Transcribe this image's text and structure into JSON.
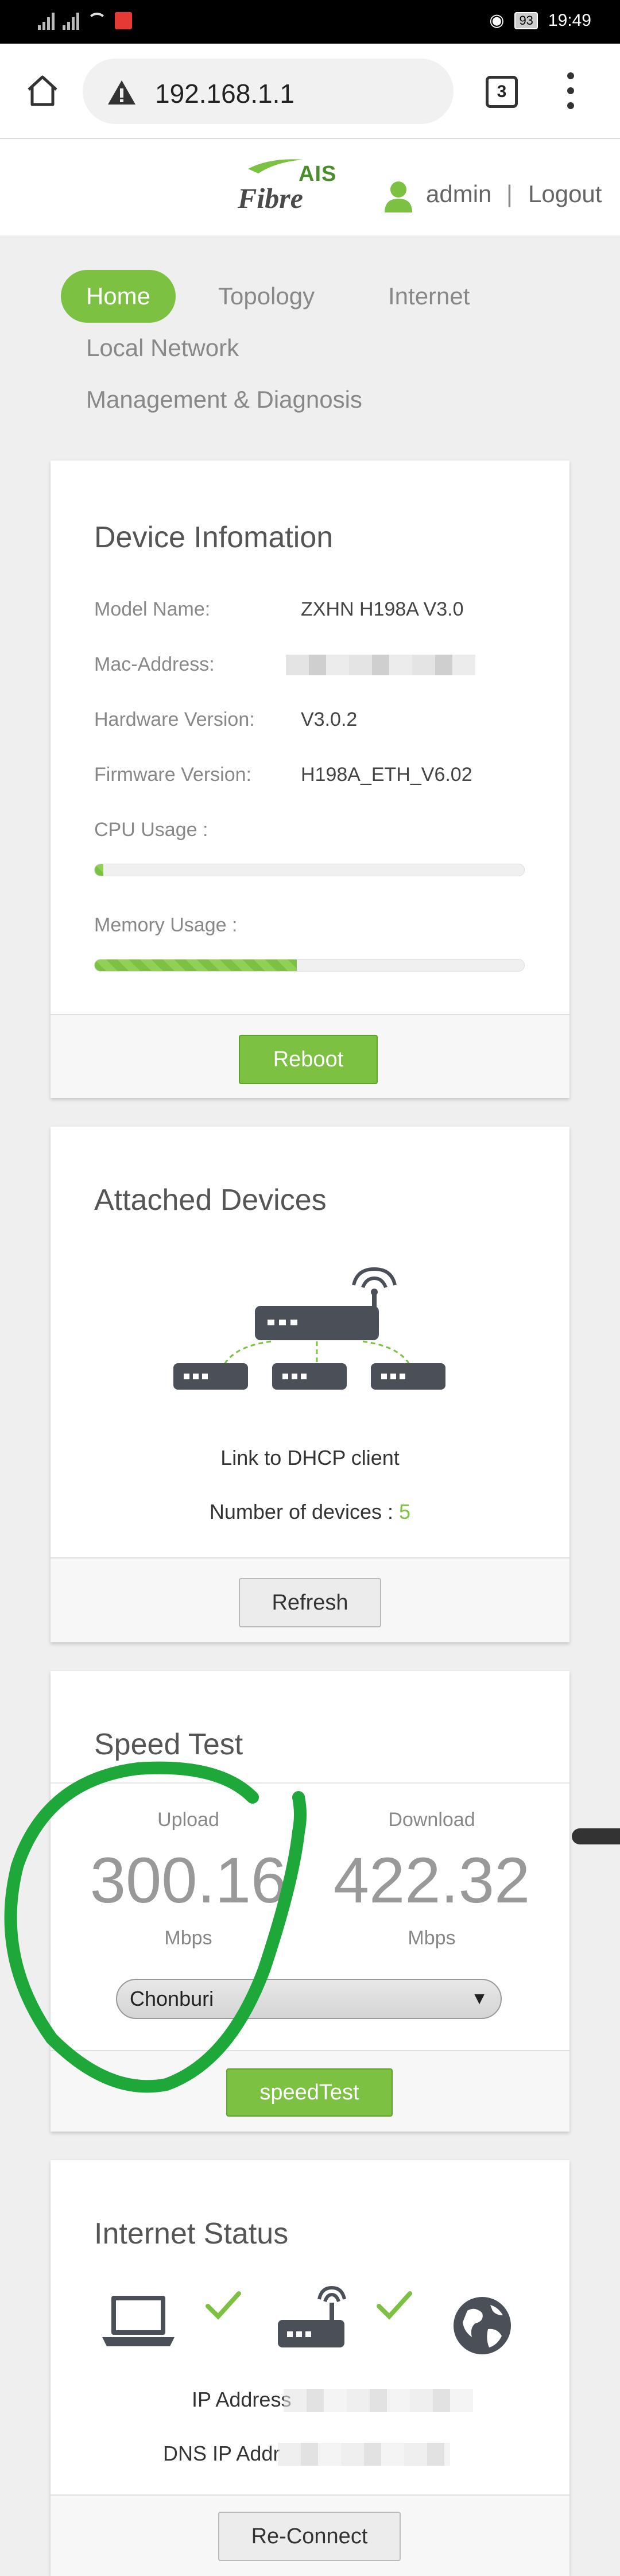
{
  "status_bar": {
    "battery": "93",
    "time": "19:49"
  },
  "browser": {
    "url": "192.168.1.1",
    "tab_count": "3"
  },
  "header": {
    "brand_top": "AIS",
    "brand_bottom": "Fibre",
    "user": "admin",
    "separator": "|",
    "logout": "Logout"
  },
  "nav": {
    "items": [
      "Home",
      "Topology",
      "Internet",
      "Local Network",
      "Management & Diagnosis"
    ],
    "active": "Home"
  },
  "device_info": {
    "title": "Device Infomation",
    "rows": [
      {
        "label": "Model Name:",
        "value": "ZXHN H198A V3.0"
      },
      {
        "label": "Mac-Address:",
        "value": ""
      },
      {
        "label": "Hardware Version:",
        "value": "V3.0.2"
      },
      {
        "label": "Firmware Version:",
        "value": "H198A_ETH_V6.02"
      }
    ],
    "cpu_label": "CPU Usage :",
    "cpu_usage_fraction": 0.02,
    "memory_label": "Memory Usage :",
    "memory_usage_fraction": 0.47,
    "reboot": "Reboot"
  },
  "attached": {
    "title": "Attached Devices",
    "link_text": "Link to DHCP client",
    "count_label": "Number of devices : ",
    "count": "5",
    "refresh": "Refresh"
  },
  "speed": {
    "title": "Speed Test",
    "upload_label": "Upload",
    "upload_value": "300.16",
    "download_label": "Download",
    "download_value": "422.32",
    "unit": "Mbps",
    "server": "Chonburi",
    "button": "speedTest"
  },
  "internet_status": {
    "title": "Internet Status",
    "ip_label": "IP Address",
    "dns_label": "DNS IP Addr",
    "reconnect": "Re-Connect"
  },
  "colors": {
    "accent": "#7cc142",
    "annotation": "#1fa83a"
  }
}
